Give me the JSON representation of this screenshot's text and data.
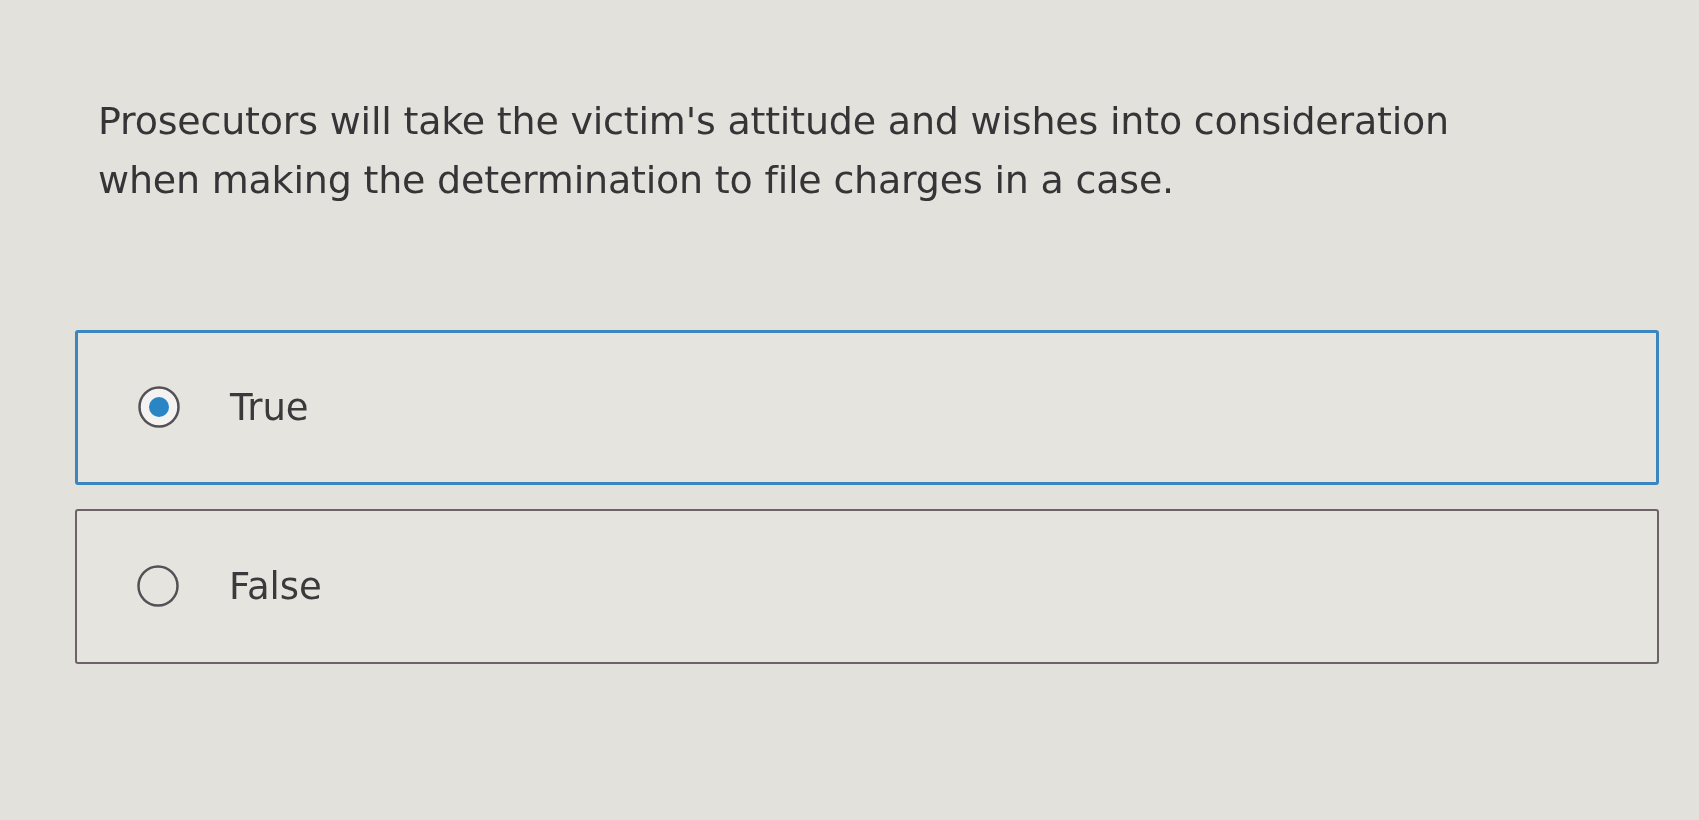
{
  "question": {
    "text": "Prosecutors will take the victim's attitude and wishes into consideration when making the determination to file charges in a case."
  },
  "options": [
    {
      "label": "True",
      "selected": true
    },
    {
      "label": "False",
      "selected": false
    }
  ]
}
